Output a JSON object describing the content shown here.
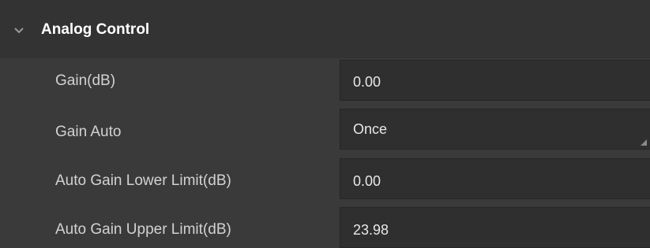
{
  "group": {
    "title": "Analog Control",
    "expand_icon": "chevron-down-icon"
  },
  "rows": [
    {
      "label": "Gain(dB)",
      "value": "0.00",
      "control": "text-input"
    },
    {
      "label": "Gain Auto",
      "value": "Once",
      "control": "dropdown"
    },
    {
      "label": "Auto Gain Lower Limit(dB)",
      "value": "0.00",
      "control": "text-input"
    },
    {
      "label": "Auto Gain Upper Limit(dB)",
      "value": "23.98",
      "control": "text-input"
    }
  ],
  "colors": {
    "background": "#3a3a3a",
    "header_background": "#333333",
    "field_background": "#2f2f2f",
    "label_text": "#d2d2d2",
    "title_text": "#ffffff"
  }
}
